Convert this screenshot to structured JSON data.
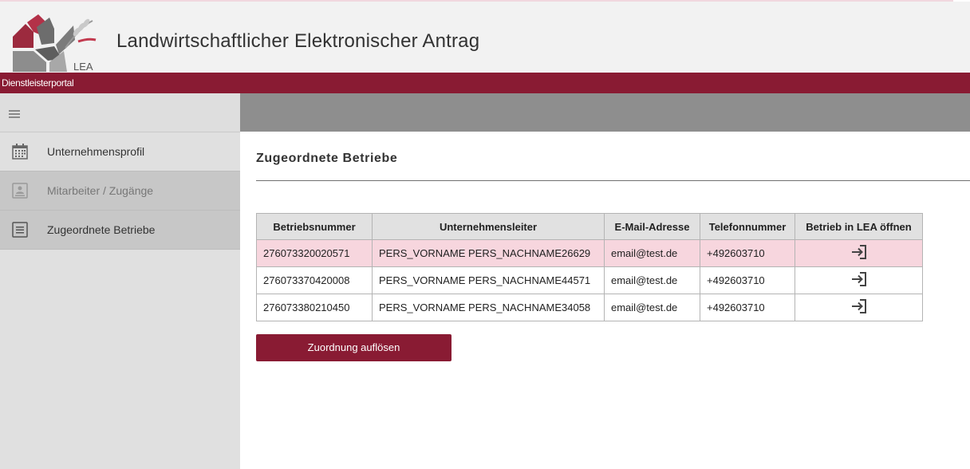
{
  "app": {
    "title": "Landwirtschaftlicher Elektronischer Antrag",
    "logo_text": "LEA",
    "portal": "Dienstleisterportal"
  },
  "colors": {
    "brand": "#891b33",
    "selected_row": "#f7d6de",
    "content_bar": "#8e8e8e"
  },
  "sidebar": {
    "menu_icon": "hamburger-icon",
    "items": [
      {
        "label": "Unternehmensprofil",
        "icon": "calendar-icon"
      },
      {
        "label": "Mitarbeiter / Zugänge",
        "icon": "person-card-icon"
      },
      {
        "label": "Zugeordnete Betriebe",
        "icon": "document-list-icon"
      }
    ]
  },
  "main": {
    "title": "Zugeordnete Betriebe",
    "table": {
      "headers": [
        "Betriebsnummer",
        "Unternehmensleiter",
        "E-Mail-Adresse",
        "Telefonnummer",
        "Betrieb in LEA öffnen"
      ],
      "rows": [
        {
          "betriebsnummer": "276073320020571",
          "leiter": "PERS_VORNAME PERS_NACHNAME26629",
          "email": "email@test.de",
          "telefon": "+492603710",
          "open_icon": "sign-in-icon",
          "selected": true
        },
        {
          "betriebsnummer": "276073370420008",
          "leiter": "PERS_VORNAME PERS_NACHNAME44571",
          "email": "email@test.de",
          "telefon": "+492603710",
          "open_icon": "sign-in-icon",
          "selected": false
        },
        {
          "betriebsnummer": "276073380210450",
          "leiter": "PERS_VORNAME PERS_NACHNAME34058",
          "email": "email@test.de",
          "telefon": "+492603710",
          "open_icon": "sign-in-icon",
          "selected": false
        }
      ]
    },
    "button_label": "Zuordnung auflösen"
  }
}
